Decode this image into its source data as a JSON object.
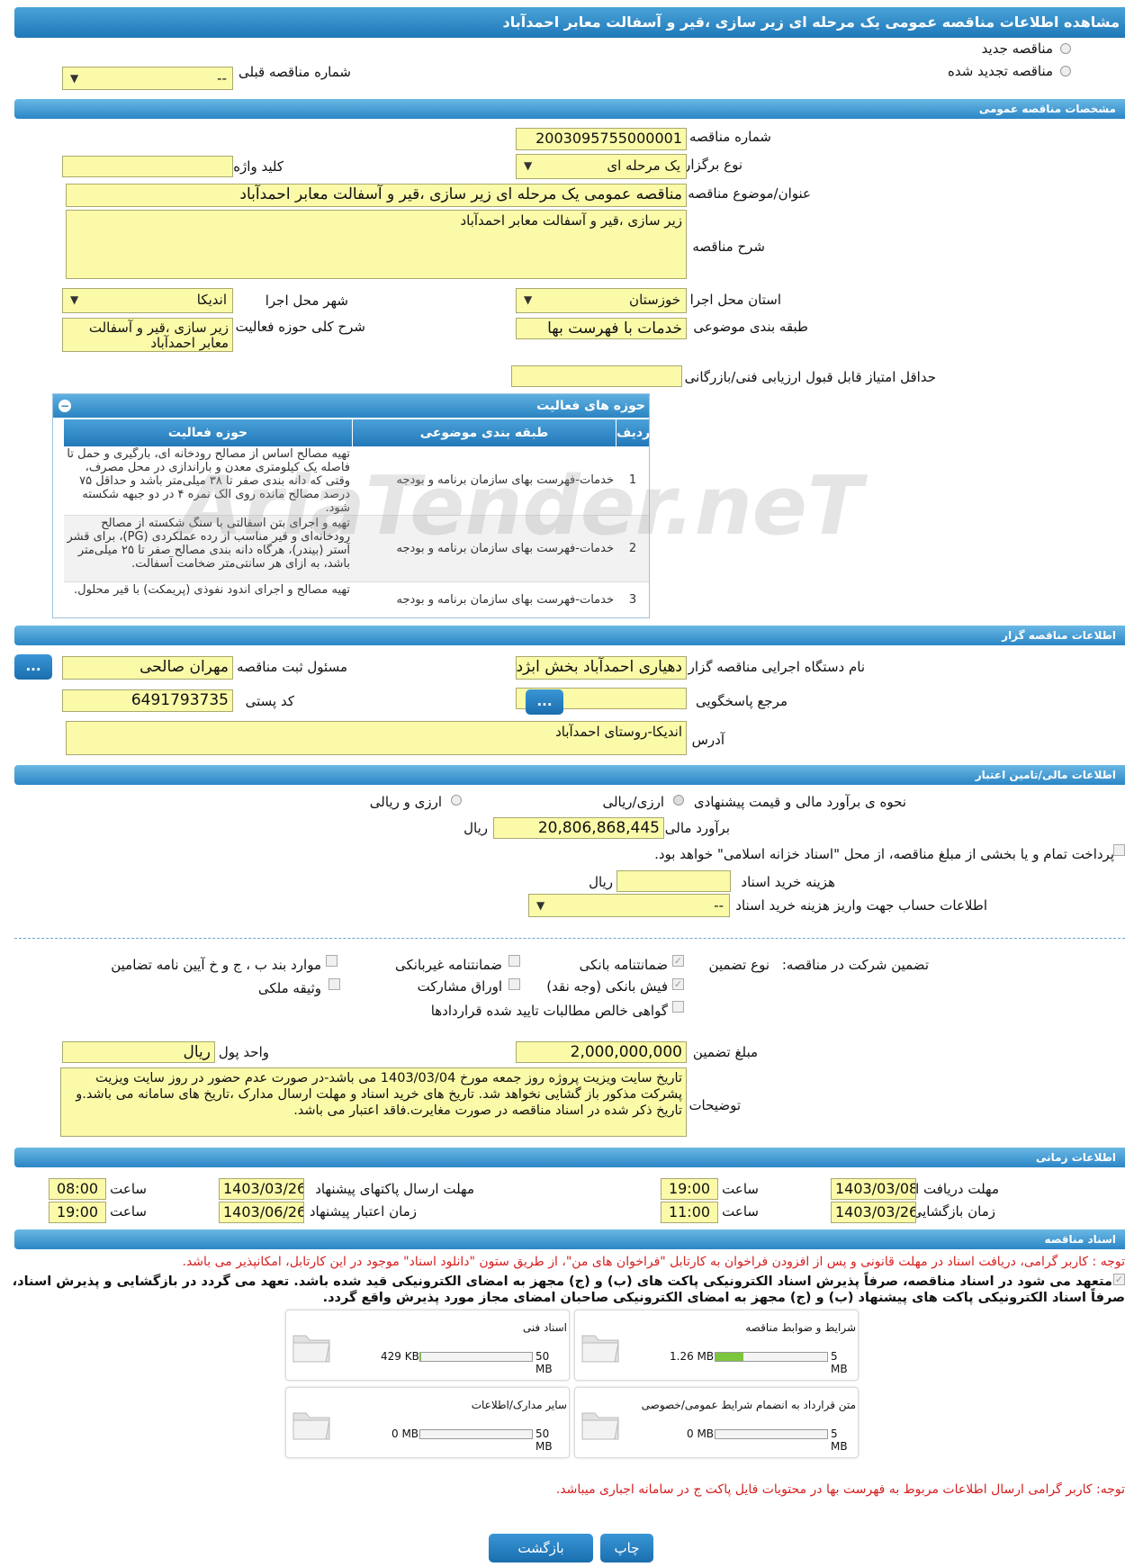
{
  "title": "مشاهده اطلاعات مناقصه عمومی یک مرحله ای زیر سازی ،قیر و آسفالت معابر احمدآباد",
  "top": {
    "new_tender": "مناقصه جدید",
    "renewed_tender": "مناقصه تجدید شده",
    "prev_number_label": "شماره مناقصه قبلی",
    "prev_number_value": "--"
  },
  "sections": {
    "general": "مشخصات مناقصه عمومی",
    "organizer": "اطلاعات مناقصه گزار",
    "financial": "اطلاعات مالی/تامین اعتبار",
    "timing": "اطلاعات زمانی",
    "documents": "اسناد مناقصه"
  },
  "general": {
    "number_label": "شماره مناقصه",
    "number_value": "2003095755000001",
    "type_label": "نوع برگزاری",
    "type_value": "یک مرحله ای",
    "keyword_label": "کلید واژه",
    "keyword_value": "",
    "subject_label": "عنوان/موضوع مناقصه",
    "subject_value": "مناقصه عمومی یک مرحله ای زیر سازی ،قیر و آسفالت معابر احمدآباد",
    "desc_label": "شرح مناقصه",
    "desc_value": "زیر سازی ،قیر و آسفالت معابر احمدآباد",
    "province_label": "استان محل اجرا",
    "province_value": "خوزستان",
    "city_label": "شهر محل اجرا",
    "city_value": "اندیکا",
    "category_label": "طبقه بندی موضوعی",
    "category_value": "خدمات با فهرست بها",
    "scope_label": "شرح کلی حوزه فعالیت",
    "scope_value": "زیر سازی ،قیر و آسفالت معابر احمدآباد",
    "min_score_label": "حداقل امتیاز قابل قبول ارزیابی فنی/بازرگانی",
    "min_score_value": ""
  },
  "activity": {
    "header": "حوزه های فعالیت",
    "cols": [
      "ردیف",
      "طبقه بندی موضوعی",
      "حوزه فعالیت"
    ],
    "rows": [
      {
        "n": "1",
        "cat": "خدمات-فهرست بهای سازمان برنامه و بودجه",
        "scope": "تهیه مصالح اساس از مصالح رودخانه ای، بارگیری و حمل تا فاصله یک کیلومتری معدن و باراندازی در محل مصرف، وقتی که دانه بندی صفر تا ۳۸ میلی‌متر باشد و حداقل ۷۵ درصد مصالح مانده روی الک نمره ۴ در دو جبهه شکسته شود."
      },
      {
        "n": "2",
        "cat": "خدمات-فهرست بهای سازمان برنامه و بودجه",
        "scope": "تهیه و اجرای بتن آسفالتی با سنگ شکسته از مصالح رودخانه‌ای و قیر مناسب از رده عملکردی (PG)، برای قشر آستر (بیندر)، هرگاه دانه بندی مصالح صفر تا ۲۵ میلی‌متر باشد، به ازای هر سانتی‌متر ضخامت آسفالت."
      },
      {
        "n": "3",
        "cat": "خدمات-فهرست بهای سازمان برنامه و بودجه",
        "scope": "تهیه مصالح و اجرای اندود نفوذی (پریمکت) با قیر محلول."
      }
    ]
  },
  "watermark": "AriaTender.neT",
  "organizer": {
    "agency_label": "نام دستگاه اجرایی مناقصه گزار",
    "agency_value": "دهیاری احمدآباد بخش ابژدان",
    "responsible_label": "مسئول ثبت مناقصه",
    "responsible_value": "مهران صالحی",
    "ref_label": "مرجع پاسخگویی",
    "ref_value": "",
    "postal_label": "کد پستی",
    "postal_value": "6491793735",
    "address_label": "آدرس",
    "address_value": "اندیکا-روستای احمدآباد",
    "more_btn": "..."
  },
  "financial": {
    "method_label": "نحوه ی برآورد مالی و قیمت پیشنهادی",
    "opt_rial": "ارزی/ریالی",
    "opt_fx": "ارزی و ریالی",
    "estimate_label": "برآورد مالی",
    "estimate_value": "20,806,868,445",
    "rial": "ریال",
    "treasury_text": "پرداخت تمام و یا بخشی از مبلغ مناقصه، از محل \"اسناد خزانه اسلامی\" خواهد بود.",
    "doc_fee_label": "هزینه خرید اسناد",
    "doc_fee_value": "",
    "account_label": "اطلاعات حساب جهت واریز هزینه خرید اسناد",
    "account_value": "--"
  },
  "guarantee": {
    "label": "تضمین شرکت در مناقصه:",
    "type_label": "نوع تضمین",
    "bank_guarantee": "ضمانتنامه بانکی",
    "nonbank_guarantee": "ضمانتنامه غیربانکی",
    "regulation": "موارد بند ب ، ج و خ آیین نامه تضامین",
    "cash_receipt": "فیش بانکی (وجه نقد)",
    "bonds": "اوراق مشارکت",
    "property": "وثیقه ملکی",
    "receivables": "گواهی خالص مطالبات تایید شده قراردادها",
    "amount_label": "مبلغ تضمین",
    "amount_value": "2,000,000,000",
    "currency_label": "واحد پول",
    "currency_value": "ریال",
    "notes_label": "توضیحات",
    "notes_value": "تاریخ سایت ویزیت پروژه روز جمعه مورخ 1403/03/04 می باشد-در صورت عدم حضور در روز سایت ویزیت پشرکت مذکور باز گشایی نخواهد شد. تاریخ های خرید اسناد و مهلت ارسال مدارک ،تاریخ های سامانه می باشد.و تاریخ ذکر شده در اسناد مناقصه در صورت مغایرت.فاقد اعتبار می باشد."
  },
  "timing": {
    "receive_label": "مهلت دریافت اسناد",
    "receive_date": "1403/03/08",
    "time_label": "ساعت",
    "receive_time": "19:00",
    "submit_label": "مهلت ارسال پاکتهای پیشنهاد",
    "submit_date": "1403/03/26",
    "submit_time": "08:00",
    "open_label": "زمان بازگشایی پاکت ها",
    "open_date": "1403/03/26",
    "open_time": "11:00",
    "validity_label": "زمان اعتبار پیشنهاد",
    "validity_date": "1403/06/26",
    "validity_time": "19:00"
  },
  "documents": {
    "notice": "توجه : کاربر گرامی، دریافت اسناد در مهلت قانونی و پس از افزودن فراخوان به کارتابل \"فراخوان های من\"، از طریق ستون \"دانلود اسناد\" موجود در این کارتابل، امکانپذیر می باشد.",
    "commit_line1": "متعهد می شود در اسناد مناقصه، صرفاً پذیرش اسناد الکترونیکی پاکت های (ب) و (ج) مجهز به امضای الکترونیکی قید شده باشد. تعهد می گردد در بازگشایی و پذیرش اسناد،",
    "commit_line2": "صرفاً اسناد الکترونیکی پاکت های پیشنهاد (ب) و (ج) مجهز به امضای الکترونیکی صاحبان امضای مجاز مورد پذیرش واقع گردد.",
    "files": [
      {
        "name": "شرایط و ضوابط مناقصه",
        "size": "1.26 MB",
        "max": "5 MB",
        "fill": 0.25
      },
      {
        "name": "اسناد فنی",
        "size": "429 KB",
        "max": "50 MB",
        "fill": 0.01
      },
      {
        "name": "متن قرارداد به انضمام شرایط عمومی/خصوصی",
        "size": "0 MB",
        "max": "5 MB",
        "fill": 0
      },
      {
        "name": "سایر مدارک/اطلاعات",
        "size": "0 MB",
        "max": "50 MB",
        "fill": 0
      }
    ],
    "footer_notice": "توجه: کاربر گرامی ارسال اطلاعات مربوط به فهرست بها در محتویات فایل پاکت ج در سامانه اجباری میباشد."
  },
  "buttons": {
    "print": "چاپ",
    "back": "بازگشت"
  },
  "colors": {
    "field_bg": "#fafaa8",
    "header_blue": "#2b86c6",
    "notice_red": "#d62020"
  }
}
